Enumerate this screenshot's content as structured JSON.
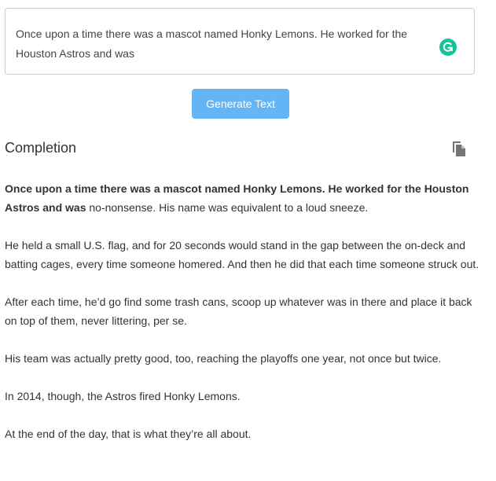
{
  "prompt": {
    "text": "Once upon a time there was a mascot named Honky Lemons. He worked for the Houston Astros and was"
  },
  "generate_button": {
    "label": "Generate Text"
  },
  "completion": {
    "heading": "Completion",
    "prompt_echo": "Once upon a time there was a mascot named Honky Lemons. He worked for the Houston Astros and was",
    "first_continuation": " no-nonsense. His name was equivalent to a loud sneeze.",
    "paragraphs": [
      "He held a small U.S. flag, and for 20 seconds would stand in the gap between the on-deck and batting cages, every time someone homered. And then he did that each time someone struck out.",
      "After each time, he’d go find some trash cans, scoop up whatever was in there and place it back on top of them, never littering, per se.",
      "His team was actually pretty good, too, reaching the playoffs one year, not once but twice.",
      "In 2014, though, the Astros fired Honky Lemons.",
      "At the end of the day, that is what they’re all about."
    ]
  },
  "icons": {
    "grammarly": "grammarly-icon",
    "copy": "copy-icon"
  },
  "colors": {
    "button": "#64b5f6",
    "grammarly": "#15c39a",
    "border": "#cccccc",
    "text": "#333333"
  }
}
